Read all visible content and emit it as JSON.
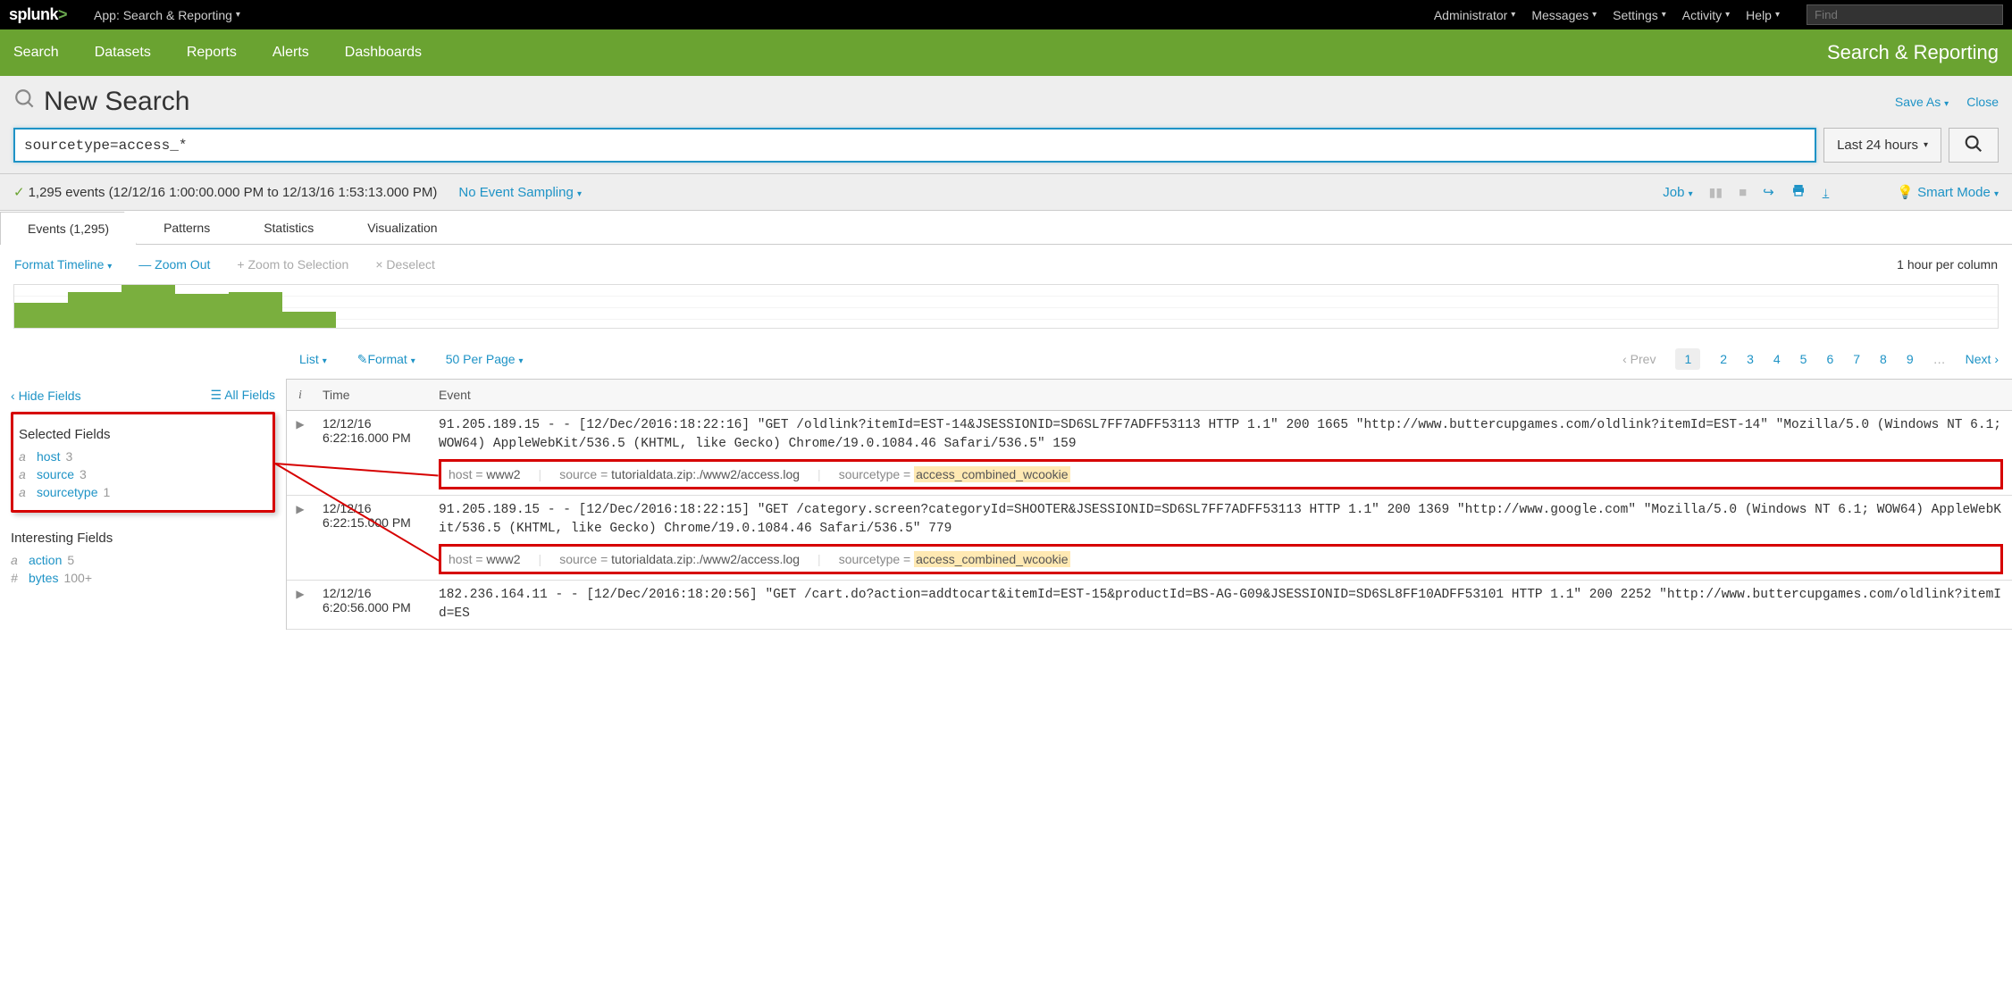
{
  "topbar": {
    "logo": "splunk",
    "app_label": "App: Search & Reporting",
    "menu": [
      "Administrator",
      "Messages",
      "Settings",
      "Activity",
      "Help"
    ],
    "find_placeholder": "Find"
  },
  "greenbar": {
    "nav": [
      "Search",
      "Datasets",
      "Reports",
      "Alerts",
      "Dashboards"
    ],
    "app_title": "Search & Reporting"
  },
  "head": {
    "title": "New Search",
    "save_as": "Save As",
    "close": "Close",
    "query": "sourcetype=access_*",
    "timerange": "Last 24 hours"
  },
  "status": {
    "summary": "1,295 events (12/12/16 1:00:00.000 PM to 12/13/16 1:53:13.000 PM)",
    "sampling": "No Event Sampling",
    "job": "Job",
    "smart": "Smart Mode"
  },
  "tabs": {
    "events": "Events (1,295)",
    "patterns": "Patterns",
    "statistics": "Statistics",
    "visualization": "Visualization"
  },
  "timeline": {
    "format": "Format Timeline",
    "zoomout": "Zoom Out",
    "zoomsel": "Zoom to Selection",
    "deselect": "Deselect",
    "granularity": "1 hour per column",
    "bars": [
      28,
      40,
      48,
      38,
      40,
      18
    ]
  },
  "controls": {
    "list": "List",
    "format": "Format",
    "perpage": "50 Per Page",
    "prev": "Prev",
    "pages": [
      "1",
      "2",
      "3",
      "4",
      "5",
      "6",
      "7",
      "8",
      "9"
    ],
    "more": "…",
    "next": "Next"
  },
  "sidebar": {
    "hide": "Hide Fields",
    "all": "All Fields",
    "selected_head": "Selected Fields",
    "selected": [
      {
        "t": "a",
        "name": "host",
        "count": "3"
      },
      {
        "t": "a",
        "name": "source",
        "count": "3"
      },
      {
        "t": "a",
        "name": "sourcetype",
        "count": "1"
      }
    ],
    "interesting_head": "Interesting Fields",
    "interesting": [
      {
        "t": "a",
        "name": "action",
        "count": "5"
      },
      {
        "t": "#",
        "name": "bytes",
        "count": "100+"
      }
    ]
  },
  "table": {
    "cols": {
      "i": "i",
      "time": "Time",
      "event": "Event"
    },
    "rows": [
      {
        "date": "12/12/16",
        "time": "6:22:16.000 PM",
        "raw": "91.205.189.15 - - [12/Dec/2016:18:22:16] \"GET /oldlink?itemId=EST-14&JSESSIONID=SD6SL7FF7ADFF53113 HTTP 1.1\" 200 1665 \"http://www.buttercupgames.com/oldlink?itemId=EST-14\" \"Mozilla/5.0 (Windows NT 6.1; WOW64) AppleWebKit/536.5 (KHTML, like Gecko) Chrome/19.0.1084.46 Safari/536.5\" 159",
        "host": "www2",
        "source": "tutorialdata.zip:./www2/access.log",
        "sourcetype": "access_combined_wcookie"
      },
      {
        "date": "12/12/16",
        "time": "6:22:15.000 PM",
        "raw": "91.205.189.15 - - [12/Dec/2016:18:22:15] \"GET /category.screen?categoryId=SHOOTER&JSESSIONID=SD6SL7FF7ADFF53113 HTTP 1.1\" 200 1369 \"http://www.google.com\" \"Mozilla/5.0 (Windows NT 6.1; WOW64) AppleWebKit/536.5 (KHTML, like Gecko) Chrome/19.0.1084.46 Safari/536.5\" 779",
        "host": "www2",
        "source": "tutorialdata.zip:./www2/access.log",
        "sourcetype": "access_combined_wcookie"
      },
      {
        "date": "12/12/16",
        "time": "6:20:56.000 PM",
        "raw": "182.236.164.11 - - [12/Dec/2016:18:20:56] \"GET /cart.do?action=addtocart&itemId=EST-15&productId=BS-AG-G09&JSESSIONID=SD6SL8FF10ADFF53101 HTTP 1.1\" 200 2252 \"http://www.buttercupgames.com/oldlink?itemId=ES"
      }
    ],
    "tag_labels": {
      "host": "host = ",
      "source": "source = ",
      "sourcetype": "sourcetype = "
    }
  }
}
